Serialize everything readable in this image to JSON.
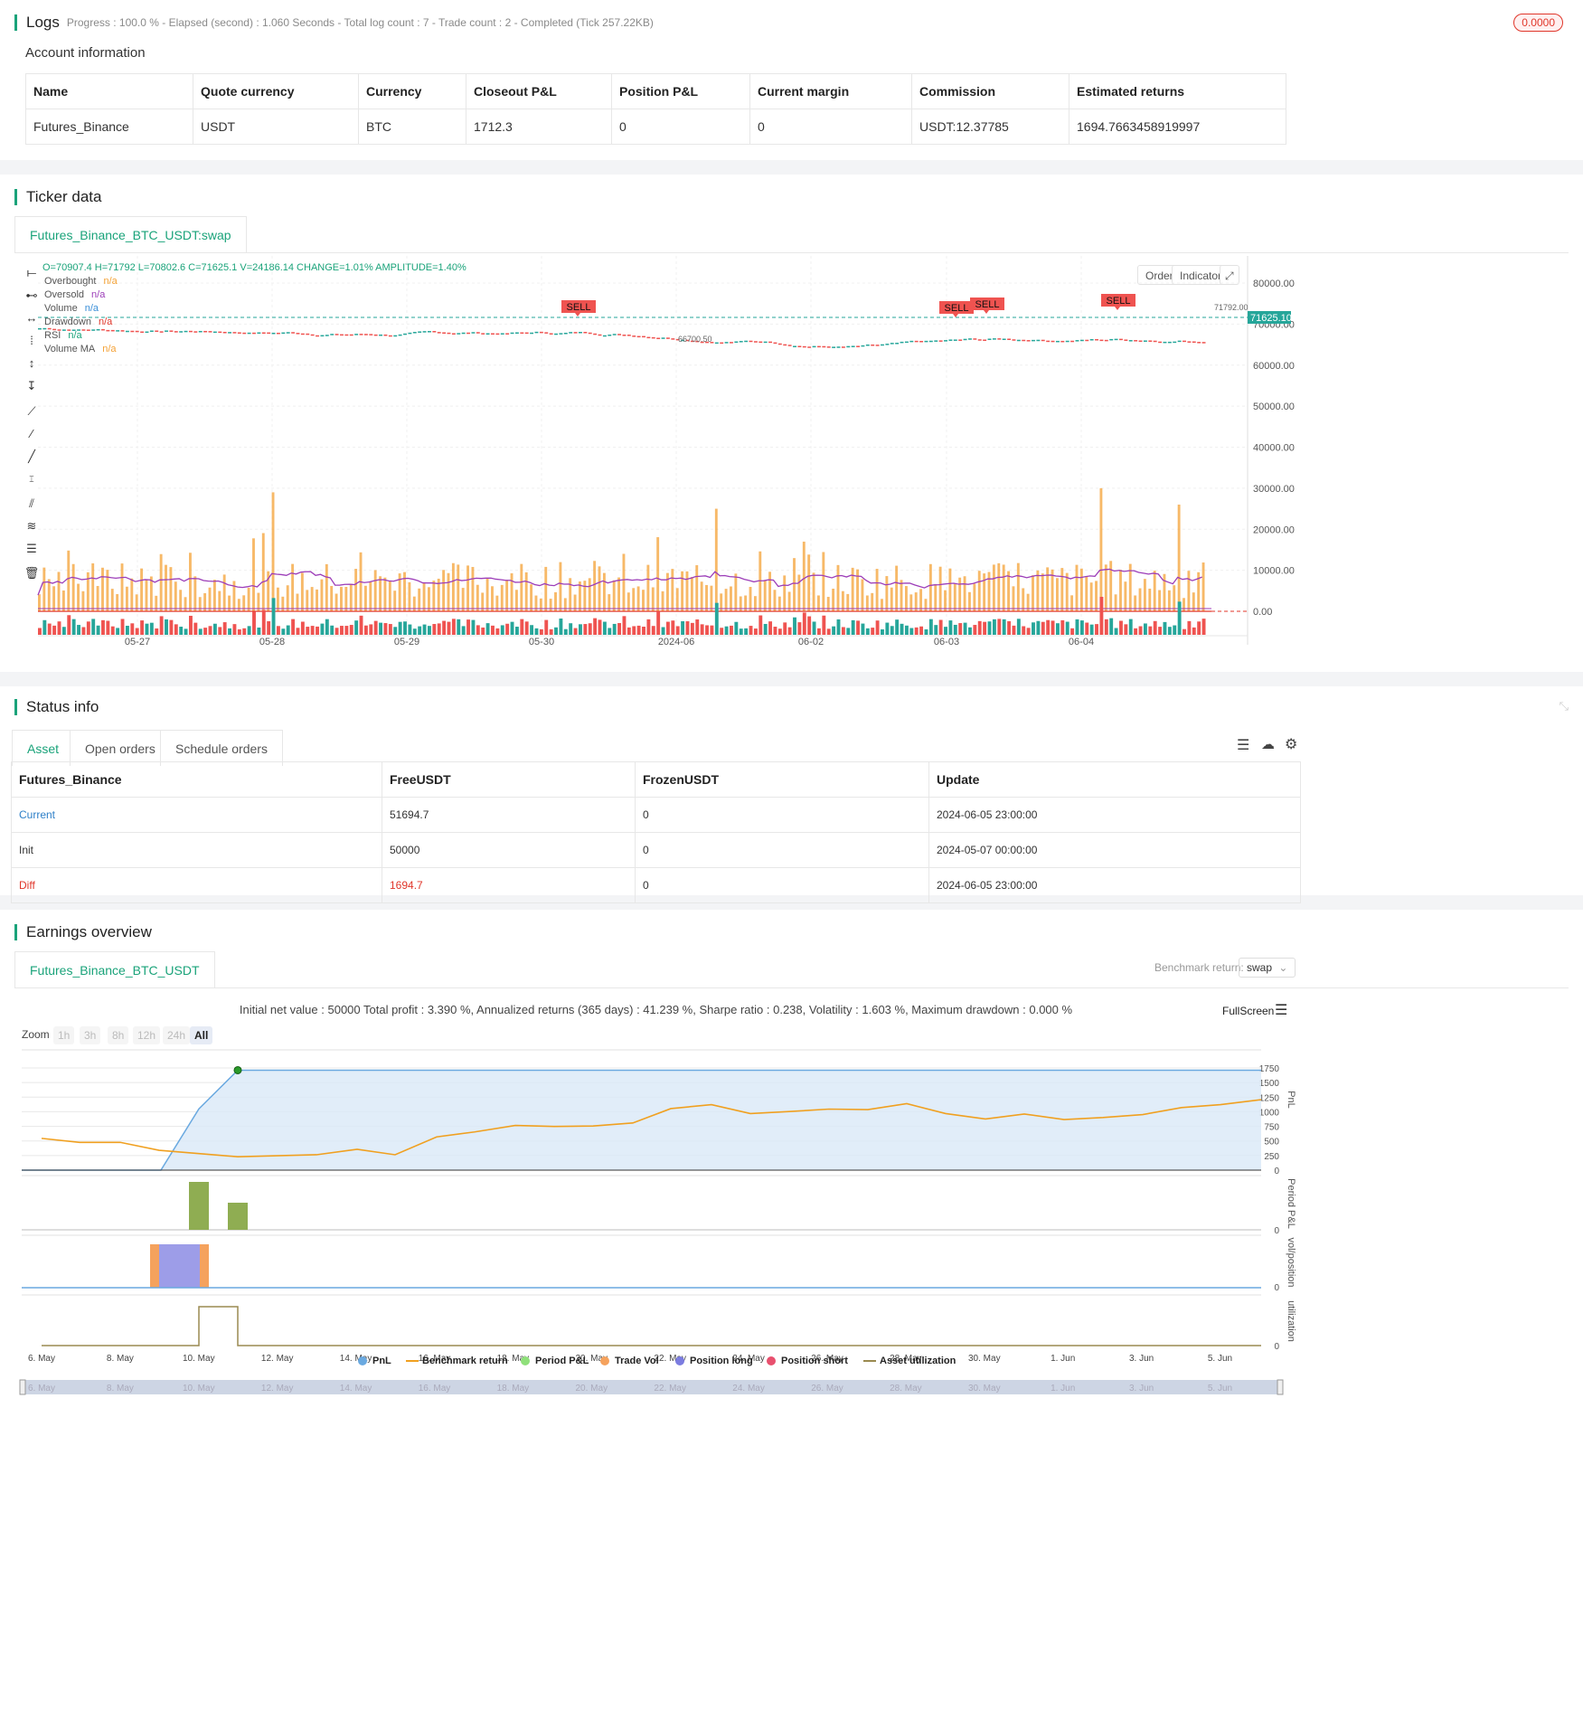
{
  "logs": {
    "title": "Logs",
    "progress_text": "Progress : 100.0 % - Elapsed (second) : 1.060 Seconds - Total log count : 7 - Trade count : 2 - Completed (Tick 257.22KB)",
    "badge": "0.0000",
    "account_title": "Account information",
    "columns": [
      "Name",
      "Quote currency",
      "Currency",
      "Closeout P&L",
      "Position P&L",
      "Current margin",
      "Commission",
      "Estimated returns"
    ],
    "row": [
      "Futures_Binance",
      "USDT",
      "BTC",
      "1712.3",
      "0",
      "0",
      "USDT:12.37785",
      "1694.7663458919997"
    ]
  },
  "ticker": {
    "title": "Ticker data",
    "tab": "Futures_Binance_BTC_USDT:swap",
    "ohlc_text": "O=70907.4 H=71792 L=70802.6 C=71625.1 V=24186.14 CHANGE=1.01% AMPLITUDE=1.40%",
    "legend": [
      {
        "name": "Overbought",
        "value": "n/a",
        "color": "#f4a236"
      },
      {
        "name": "Oversold",
        "value": "n/a",
        "color": "#9c3db8"
      },
      {
        "name": "Volume",
        "value": "n/a",
        "color": "#3a8fd8"
      },
      {
        "name": "Drawdown",
        "value": "n/a",
        "color": "#e0362a"
      },
      {
        "name": "RSI",
        "value": "n/a",
        "color": "#1aa37a"
      },
      {
        "name": "Volume MA",
        "value": "n/a",
        "color": "#f4a236"
      }
    ],
    "buttons": {
      "order": "Order",
      "indicator": "Indicator"
    },
    "y_ticks": [
      "80000.00",
      "70000.00",
      "60000.00",
      "50000.00",
      "40000.00",
      "30000.00",
      "20000.00",
      "10000.00",
      "0.00"
    ],
    "x_ticks": [
      "05-27",
      "05-28",
      "05-29",
      "05-30",
      "2024-06",
      "06-02",
      "06-03",
      "06-04"
    ],
    "price_tag": "71625.10",
    "high_label": "71792.00",
    "low_label": "66700.50",
    "sell_label": "SELL",
    "colors": {
      "up": "#26a69a",
      "down": "#ef5350",
      "volume": "#f4a236",
      "ma": "#9c3db8"
    }
  },
  "status": {
    "title": "Status info",
    "tabs": [
      "Asset",
      "Open orders",
      "Schedule orders"
    ],
    "columns": [
      "Futures_Binance",
      "FreeUSDT",
      "FrozenUSDT",
      "Update"
    ],
    "rows": [
      [
        "Current",
        "51694.7",
        "0",
        "2024-06-05 23:00:00"
      ],
      [
        "Init",
        "50000",
        "0",
        "2024-05-07 00:00:00"
      ],
      [
        "Diff",
        "1694.7",
        "0",
        "2024-06-05 23:00:00"
      ]
    ]
  },
  "earnings": {
    "title": "Earnings overview",
    "tab": "Futures_Binance_BTC_USDT",
    "benchmark_label": "Benchmark return:",
    "benchmark_value": "swap",
    "summary": "Initial net value : 50000 Total profit : 3.390 %, Annualized returns (365 days) : 41.239 %, Sharpe ratio : 0.238, Volatility : 1.603 %, Maximum drawdown : 0.000 %",
    "fullscreen": "FullScreen",
    "zoom_label": "Zoom",
    "zoom_options": [
      "1h",
      "3h",
      "8h",
      "12h",
      "24h",
      "All"
    ],
    "pnl_ticks": [
      "1750",
      "1500",
      "1250",
      "1000",
      "750",
      "500",
      "250",
      "0"
    ],
    "axis_titles": [
      "PnL",
      "Period P&L",
      "vol/position",
      "utilization"
    ],
    "zero": "0",
    "x_ticks": [
      "6. May",
      "8. May",
      "10. May",
      "12. May",
      "14. May",
      "16. May",
      "18. May",
      "20. May",
      "22. May",
      "24. May",
      "26. May",
      "28. May",
      "30. May",
      "1. Jun",
      "3. Jun",
      "5. Jun"
    ],
    "legend": [
      {
        "name": "PnL",
        "color": "#6aa9e0"
      },
      {
        "name": "Benchmark return",
        "color": "#f0a020"
      },
      {
        "name": "Period P&L",
        "color": "#8fe07a"
      },
      {
        "name": "Trade Vol",
        "color": "#f5a25d"
      },
      {
        "name": "Position long",
        "color": "#7b7ce0"
      },
      {
        "name": "Position short",
        "color": "#e8506e"
      },
      {
        "name": "Asset utilization",
        "color": "#9a8a50"
      }
    ]
  }
}
